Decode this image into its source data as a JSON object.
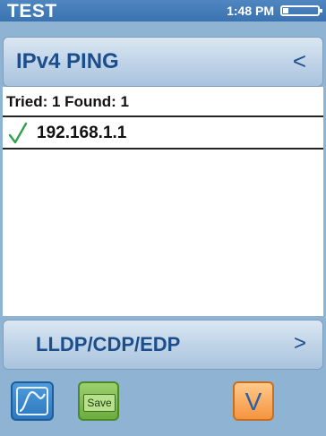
{
  "status_bar": {
    "title": "TEST",
    "time": "1:48 PM",
    "battery_level": 0.15
  },
  "header_button": {
    "label": "IPv4 PING",
    "nav_symbol": "<"
  },
  "results": {
    "summary": "Tried: 1 Found: 1",
    "items": [
      {
        "status_icon": "check-icon",
        "address": "192.168.1.1"
      }
    ]
  },
  "footer_button": {
    "label": "LLDP/CDP/EDP",
    "nav_symbol": ">"
  },
  "toolbar": {
    "graph_icon": "graph-icon",
    "save_label": "Save",
    "down_symbol": "V"
  },
  "colors": {
    "background": "#8fb4d3",
    "status_bar": "#3a73b0",
    "button_text": "#1c4e8c",
    "check": "#2fa34a",
    "save_button": "#6eac3f",
    "down_button": "#f5943f"
  }
}
